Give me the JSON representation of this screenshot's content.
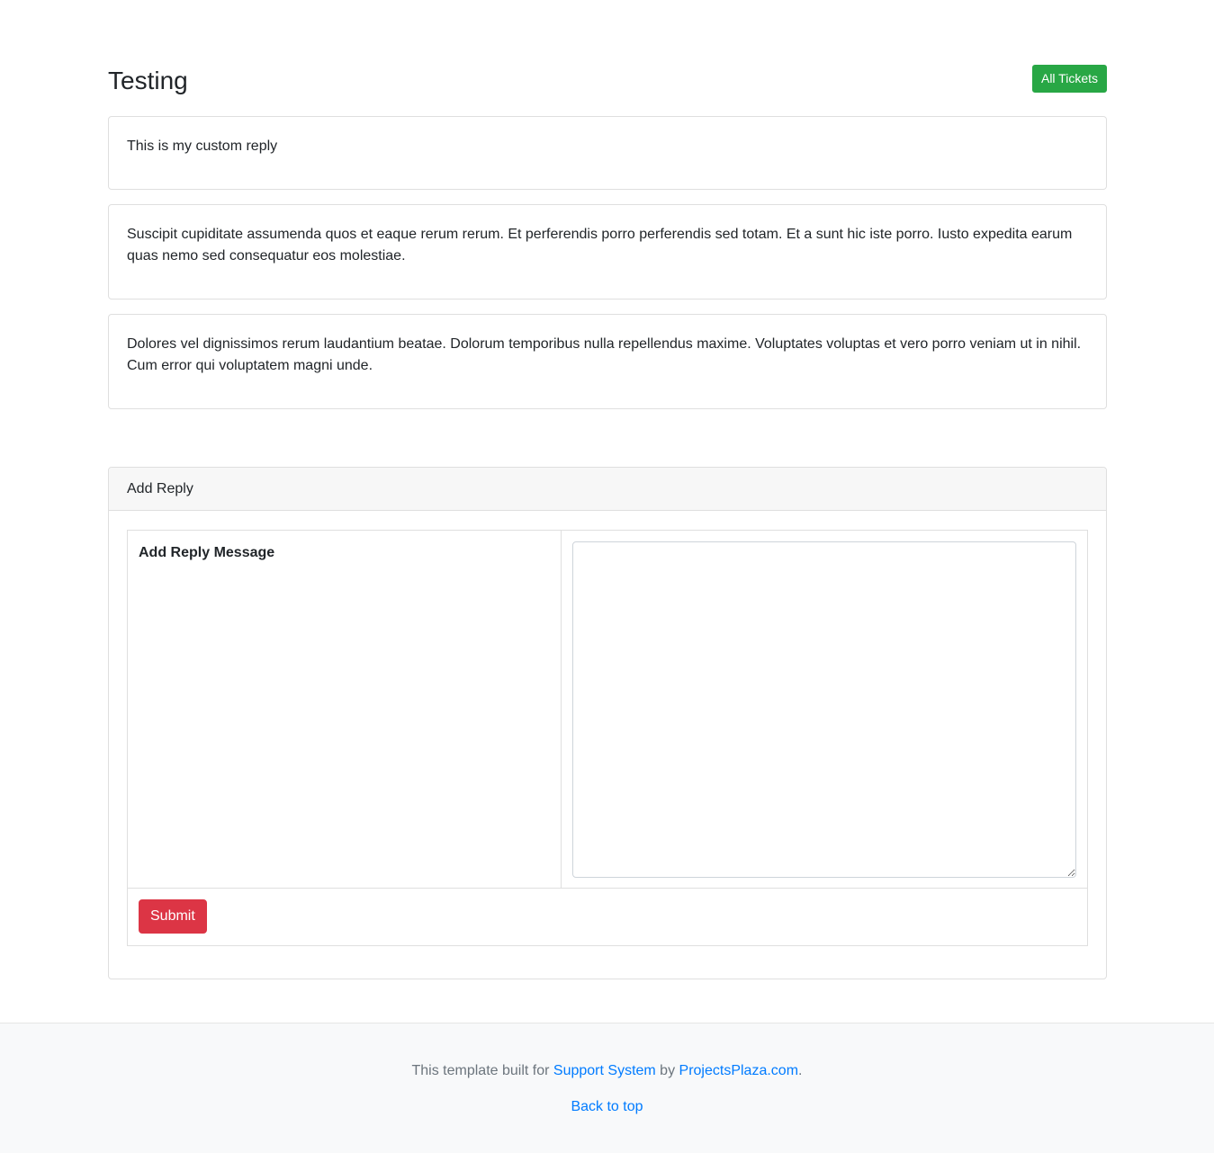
{
  "page": {
    "title": "Testing",
    "all_tickets_label": "All Tickets"
  },
  "replies": [
    {
      "text": "This is my custom reply"
    },
    {
      "text": "Suscipit cupiditate assumenda quos et eaque rerum rerum. Et perferendis porro perferendis sed totam. Et a sunt hic iste porro. Iusto expedita earum quas nemo sed consequatur eos molestiae."
    },
    {
      "text": "Dolores vel dignissimos rerum laudantium beatae. Dolorum temporibus nulla repellendus maxime. Voluptates voluptas et vero porro veniam ut in nihil. Cum error qui voluptatem magni unde."
    }
  ],
  "add_reply": {
    "header": "Add Reply",
    "field_label": "Add Reply Message",
    "field_value": "",
    "submit_label": "Submit"
  },
  "footer": {
    "prefix": "This template built for ",
    "link1": "Support System",
    "middle": " by ",
    "link2": "ProjectsPlaza.com",
    "suffix": ".",
    "back_to_top": "Back to top"
  },
  "colors": {
    "success": "#28a745",
    "danger": "#dc3545",
    "link": "#007bff"
  }
}
